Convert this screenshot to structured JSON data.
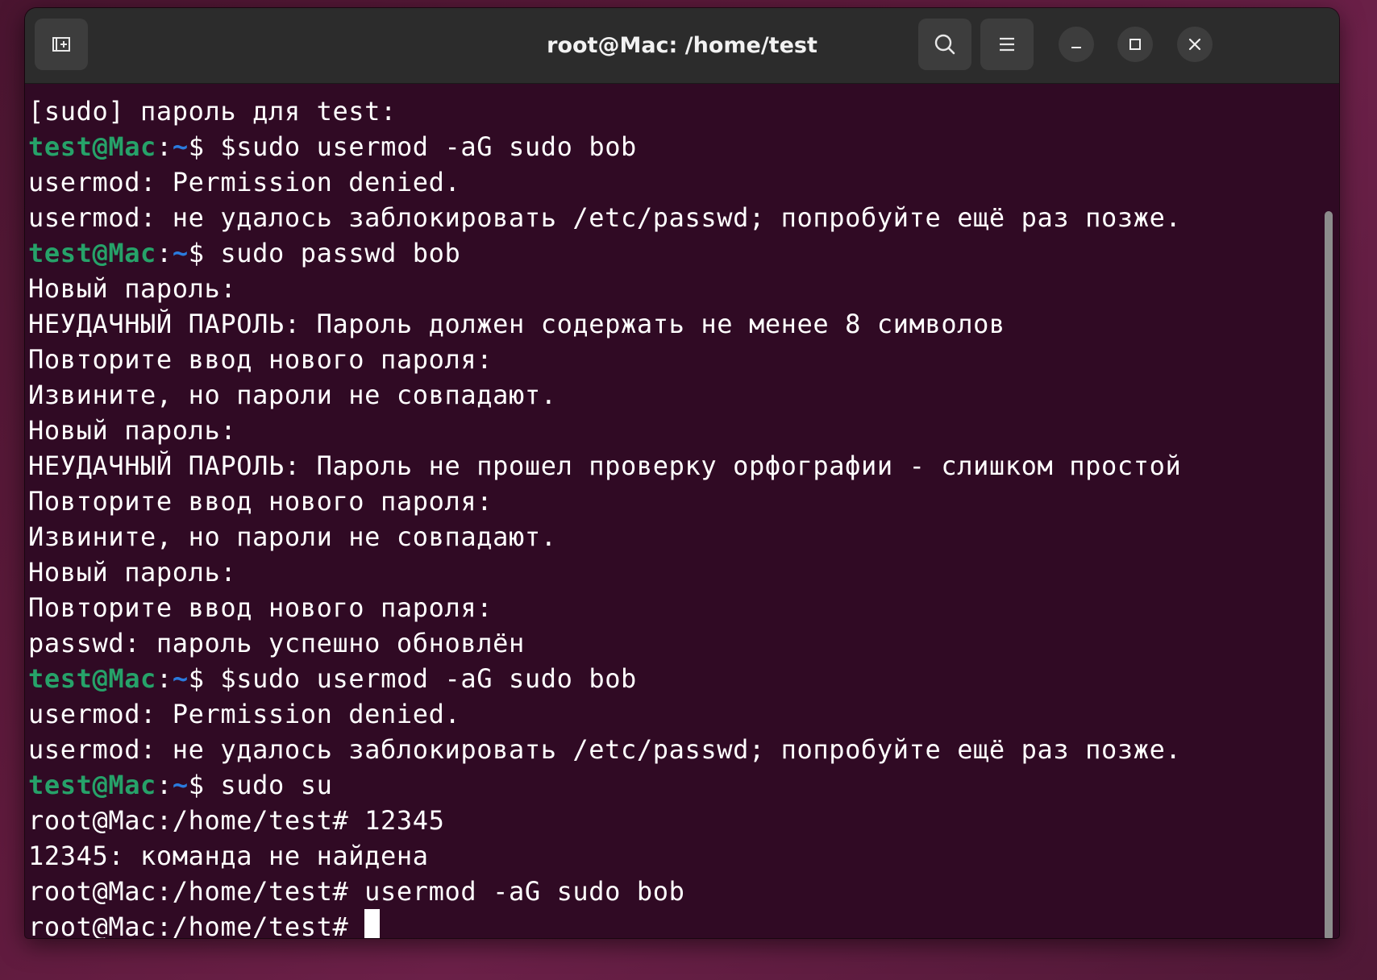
{
  "window": {
    "title": "root@Mac: /home/test"
  },
  "titlebar": {
    "new_tab_icon": "new-tab-icon",
    "search_icon": "search-icon",
    "menu_icon": "hamburger-menu-icon",
    "minimize_icon": "minimize-icon",
    "maximize_icon": "maximize-icon",
    "close_icon": "close-icon"
  },
  "colors": {
    "terminal_bg": "#300a24",
    "prompt_user": "#26a269",
    "prompt_path": "#2a7bde",
    "text": "#ffffff",
    "titlebar_bg": "#2c2c2c"
  },
  "terminal": {
    "lines": [
      {
        "type": "output",
        "text": "[sudo] пароль для test:"
      },
      {
        "type": "prompt",
        "user": "test@Mac",
        "colon": ":",
        "path": "~",
        "symbol": "$ ",
        "command": "$sudo usermod -aG sudo bob"
      },
      {
        "type": "output",
        "text": "usermod: Permission denied."
      },
      {
        "type": "output",
        "text": "usermod: не удалось заблокировать /etc/passwd; попробуйте ещё раз позже."
      },
      {
        "type": "prompt",
        "user": "test@Mac",
        "colon": ":",
        "path": "~",
        "symbol": "$ ",
        "command": "sudo passwd bob"
      },
      {
        "type": "output",
        "text": "Новый пароль:"
      },
      {
        "type": "output",
        "text": "НЕУДАЧНЫЙ ПАРОЛЬ: Пароль должен содержать не менее 8 символов"
      },
      {
        "type": "output",
        "text": "Повторите ввод нового пароля:"
      },
      {
        "type": "output",
        "text": "Извините, но пароли не совпадают."
      },
      {
        "type": "output",
        "text": "Новый пароль:"
      },
      {
        "type": "output",
        "text": "НЕУДАЧНЫЙ ПАРОЛЬ: Пароль не прошел проверку орфографии - слишком простой"
      },
      {
        "type": "output",
        "text": "Повторите ввод нового пароля:"
      },
      {
        "type": "output",
        "text": "Извините, но пароли не совпадают."
      },
      {
        "type": "output",
        "text": "Новый пароль:"
      },
      {
        "type": "output",
        "text": "Повторите ввод нового пароля:"
      },
      {
        "type": "output",
        "text": "passwd: пароль успешно обновлён"
      },
      {
        "type": "prompt",
        "user": "test@Mac",
        "colon": ":",
        "path": "~",
        "symbol": "$ ",
        "command": "$sudo usermod -aG sudo bob"
      },
      {
        "type": "output",
        "text": "usermod: Permission denied."
      },
      {
        "type": "output",
        "text": "usermod: не удалось заблокировать /etc/passwd; попробуйте ещё раз позже."
      },
      {
        "type": "prompt",
        "user": "test@Mac",
        "colon": ":",
        "path": "~",
        "symbol": "$ ",
        "command": "sudo su"
      },
      {
        "type": "output",
        "text": "root@Mac:/home/test# 12345"
      },
      {
        "type": "output",
        "text": "12345: команда не найдена"
      },
      {
        "type": "output",
        "text": "root@Mac:/home/test# usermod -aG sudo bob"
      },
      {
        "type": "cursor",
        "text": "root@Mac:/home/test# "
      }
    ]
  }
}
